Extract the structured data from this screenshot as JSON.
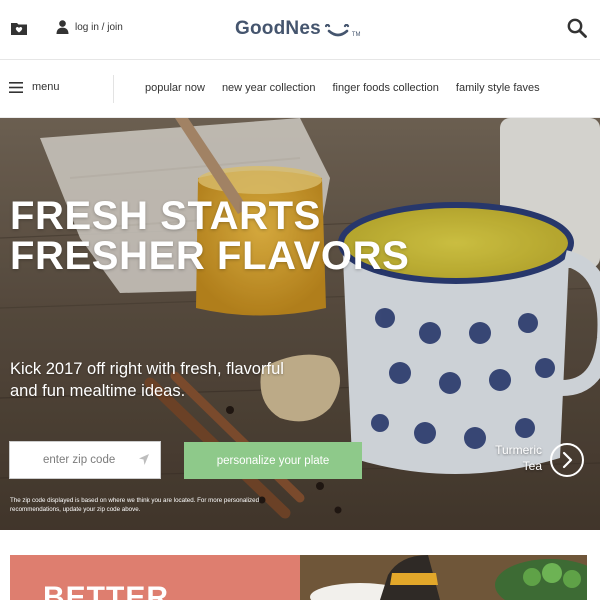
{
  "header": {
    "login_label": "log in / join",
    "logo_text": "GoodNes",
    "logo_tm": "TM",
    "icons": [
      "heart-folder-icon",
      "user-icon",
      "smile-logo-icon",
      "search-icon"
    ],
    "brand_color": "#45556e"
  },
  "nav": {
    "menu_label": "menu",
    "links": [
      "popular now",
      "new year collection",
      "finger foods collection",
      "family style faves"
    ]
  },
  "hero": {
    "title_line1": "FRESH STARTS",
    "title_line2": "FRESHER FLAVORS",
    "subtitle": "Kick 2017 off right with fresh, flavorful and fun mealtime ideas.",
    "zip_placeholder": "enter zip code",
    "cta_label": "personalize your plate",
    "cta_color": "#8ec98a",
    "caption_line1": "Turmeric",
    "caption_line2": "Tea",
    "note": "The zip code displayed is based on where we think you are located. For more personalized recommendations, update your zip code above."
  },
  "lower": {
    "card_title": "BETTER",
    "card_color": "#de7e6f"
  }
}
